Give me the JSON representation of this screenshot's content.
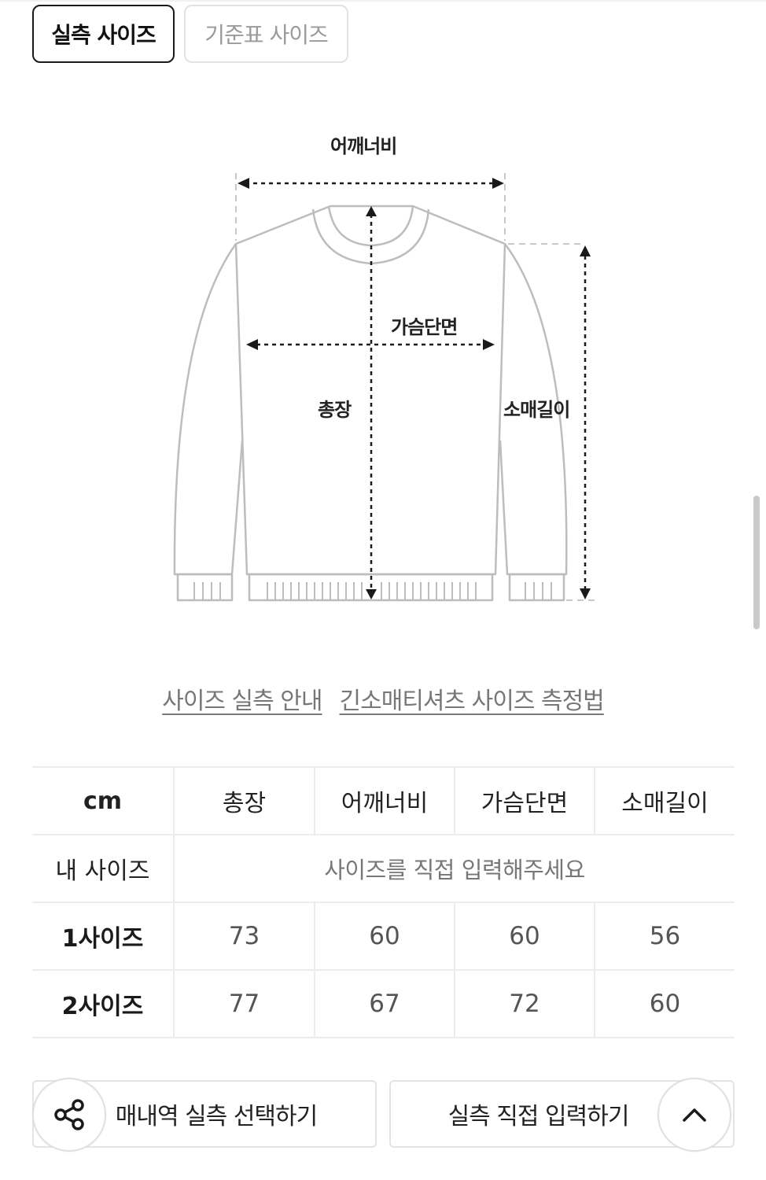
{
  "tabs": {
    "measured": "실측 사이즈",
    "standard": "기준표 사이즈"
  },
  "diagram": {
    "shoulder": "어깨너비",
    "chest": "가슴단면",
    "length": "총장",
    "sleeve": "소매길이"
  },
  "links": {
    "guide": "사이즈 실측 안내",
    "method": "긴소매티셔츠 사이즈 측정법"
  },
  "table": {
    "headers": [
      "cm",
      "총장",
      "어깨너비",
      "가슴단면",
      "소매길이"
    ],
    "my_size_label": "내 사이즈",
    "my_size_prompt": "사이즈를 직접 입력해주세요",
    "rows": [
      {
        "label": "1사이즈",
        "values": [
          "73",
          "60",
          "60",
          "56"
        ]
      },
      {
        "label": "2사이즈",
        "values": [
          "77",
          "67",
          "72",
          "60"
        ]
      }
    ]
  },
  "buttons": {
    "purchase_history": "매내역 실측 선택하기",
    "direct_input": "실측 직접 입력하기"
  },
  "icons": {
    "share": "share-icon",
    "up": "chevron-up-icon"
  }
}
